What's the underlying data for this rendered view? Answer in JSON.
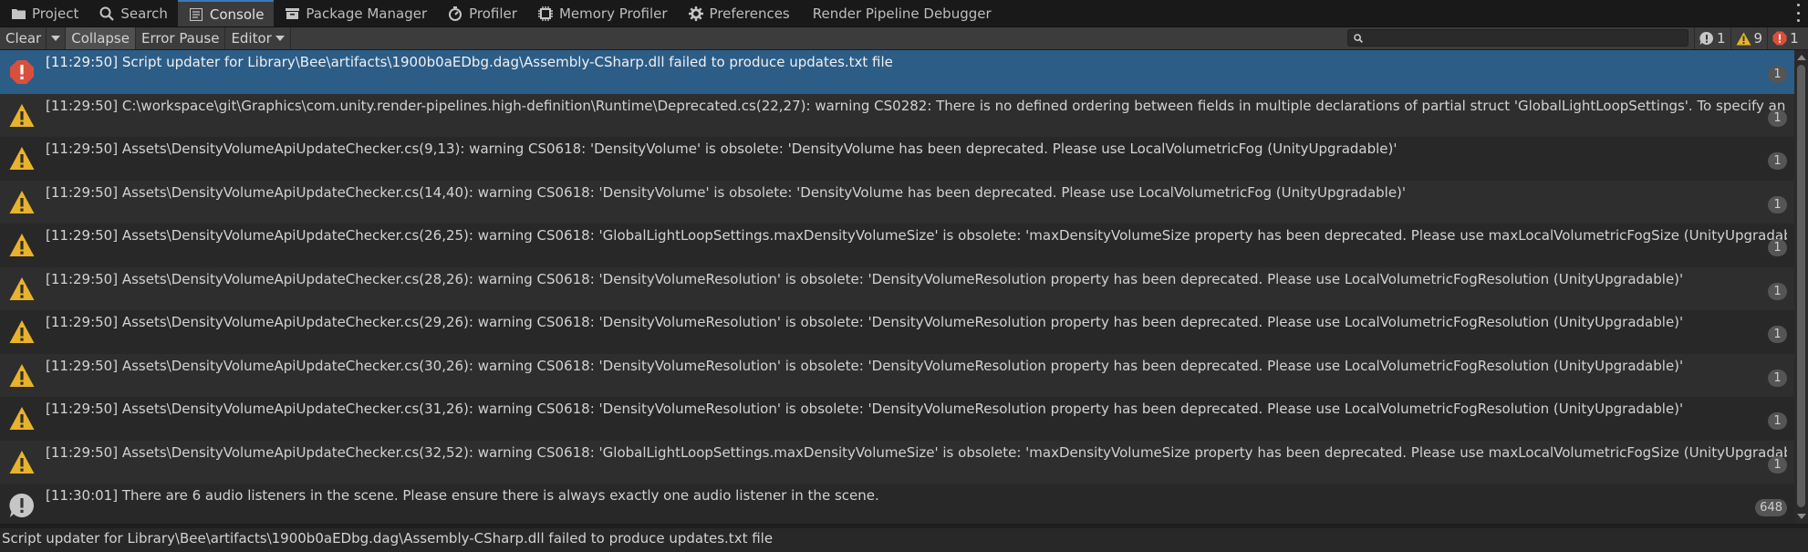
{
  "tabs": [
    {
      "label": "Project",
      "icon": "folder-icon"
    },
    {
      "label": "Search",
      "icon": "search-icon"
    },
    {
      "label": "Console",
      "icon": "console-icon",
      "active": true
    },
    {
      "label": "Package Manager",
      "icon": "package-icon"
    },
    {
      "label": "Profiler",
      "icon": "profiler-icon"
    },
    {
      "label": "Memory Profiler",
      "icon": "memory-chip-icon"
    },
    {
      "label": "Preferences",
      "icon": "gear-icon"
    },
    {
      "label": "Render Pipeline Debugger",
      "icon": ""
    }
  ],
  "toolbar": {
    "clear_label": "Clear",
    "collapse_label": "Collapse",
    "error_pause_label": "Error Pause",
    "editor_label": "Editor",
    "search_value": "",
    "counts": {
      "info": "1",
      "warning": "9",
      "error": "1"
    }
  },
  "colors": {
    "selection": "#2c5d87",
    "error": "#d8503c",
    "warning": "#e8b32a",
    "info": "#c6c6c6"
  },
  "logs": [
    {
      "type": "error",
      "text": "[11:29:50] Script updater for Library\\Bee\\artifacts\\1900b0aEDbg.dag\\Assembly-CSharp.dll failed to produce updates.txt file",
      "count": "1",
      "selected": true
    },
    {
      "type": "warning",
      "text": "[11:29:50] C:\\workspace\\git\\Graphics\\com.unity.render-pipelines.high-definition\\Runtime\\Deprecated.cs(22,27): warning CS0282: There is no defined ordering between fields in multiple declarations of partial struct 'GlobalLightLoopSettings'. To specify an ordering, all",
      "count": "1"
    },
    {
      "type": "warning",
      "text": "[11:29:50] Assets\\DensityVolumeApiUpdateChecker.cs(9,13): warning CS0618: 'DensityVolume' is obsolete: 'DensityVolume has been deprecated. Please use LocalVolumetricFog (UnityUpgradable)'",
      "count": "1"
    },
    {
      "type": "warning",
      "text": "[11:29:50] Assets\\DensityVolumeApiUpdateChecker.cs(14,40): warning CS0618: 'DensityVolume' is obsolete: 'DensityVolume has been deprecated. Please use LocalVolumetricFog (UnityUpgradable)'",
      "count": "1"
    },
    {
      "type": "warning",
      "text": "[11:29:50] Assets\\DensityVolumeApiUpdateChecker.cs(26,25): warning CS0618: 'GlobalLightLoopSettings.maxDensityVolumeSize' is obsolete: 'maxDensityVolumeSize property has been deprecated. Please use maxLocalVolumetricFogSize (UnityUpgradable)'",
      "count": "1"
    },
    {
      "type": "warning",
      "text": "[11:29:50] Assets\\DensityVolumeApiUpdateChecker.cs(28,26): warning CS0618: 'DensityVolumeResolution' is obsolete: 'DensityVolumeResolution property has been deprecated. Please use LocalVolumetricFogResolution (UnityUpgradable)'",
      "count": "1"
    },
    {
      "type": "warning",
      "text": "[11:29:50] Assets\\DensityVolumeApiUpdateChecker.cs(29,26): warning CS0618: 'DensityVolumeResolution' is obsolete: 'DensityVolumeResolution property has been deprecated. Please use LocalVolumetricFogResolution (UnityUpgradable)'",
      "count": "1"
    },
    {
      "type": "warning",
      "text": "[11:29:50] Assets\\DensityVolumeApiUpdateChecker.cs(30,26): warning CS0618: 'DensityVolumeResolution' is obsolete: 'DensityVolumeResolution property has been deprecated. Please use LocalVolumetricFogResolution (UnityUpgradable)'",
      "count": "1"
    },
    {
      "type": "warning",
      "text": "[11:29:50] Assets\\DensityVolumeApiUpdateChecker.cs(31,26): warning CS0618: 'DensityVolumeResolution' is obsolete: 'DensityVolumeResolution property has been deprecated. Please use LocalVolumetricFogResolution (UnityUpgradable)'",
      "count": "1"
    },
    {
      "type": "warning",
      "text": "[11:29:50] Assets\\DensityVolumeApiUpdateChecker.cs(32,52): warning CS0618: 'GlobalLightLoopSettings.maxDensityVolumeSize' is obsolete: 'maxDensityVolumeSize property has been deprecated. Please use maxLocalVolumetricFogSize (UnityUpgradable)'",
      "count": "1"
    },
    {
      "type": "info",
      "text": "[11:30:01] There are 6 audio listeners in the scene. Please ensure there is always exactly one audio listener in the scene.",
      "count": "648"
    }
  ],
  "details": {
    "text": "Script updater for Library\\Bee\\artifacts\\1900b0aEDbg.dag\\Assembly-CSharp.dll failed to produce updates.txt file"
  }
}
